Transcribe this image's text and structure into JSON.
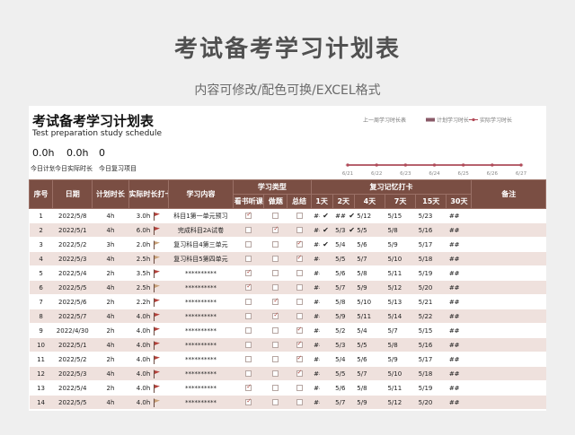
{
  "banner": {
    "title": "考试备考学习计划表",
    "subtitle": "内容可修改/配色可换/EXCEL格式"
  },
  "sheet": {
    "title": "考试备考学习计划表",
    "subtitle": "Test preparation study schedule",
    "stats": [
      {
        "value": "0.0h",
        "label": "今日计划"
      },
      {
        "value": "0.0h",
        "label": "今日实际时长"
      },
      {
        "value": "0",
        "label": "今日复习项目"
      }
    ]
  },
  "chart_data": {
    "type": "line",
    "title": "上一周学习时长表",
    "x": [
      "6/21",
      "6/22",
      "6/23",
      "6/24",
      "6/25",
      "6/26",
      "6/27"
    ],
    "series": [
      {
        "name": "计划学习时长",
        "values": [
          0,
          0,
          0,
          0,
          0,
          0,
          0
        ],
        "color": "#8a5a68"
      },
      {
        "name": "实际学习时长",
        "values": [
          0,
          0,
          0,
          0,
          0,
          0,
          0
        ],
        "color": "#b24a58"
      }
    ]
  },
  "table": {
    "headers": {
      "idx": "序号",
      "date": "日期",
      "plan": "计划时长",
      "actual": "实际时长打卡",
      "content": "学习内容",
      "type_group": "学习类型",
      "review_group": "复习记忆打卡",
      "note": "备注",
      "type_cols": [
        "看书听课",
        "做题",
        "总结"
      ],
      "review_cols": [
        "1天",
        "2天",
        "4天",
        "7天",
        "15天",
        "30天"
      ]
    },
    "rows": [
      {
        "idx": "1",
        "date": "2022/5/8",
        "plan": "4h",
        "actual": "3.0h",
        "flag": "red",
        "content": "科目1第一单元预习",
        "types": [
          1,
          0,
          0
        ],
        "r": [
          "##",
          "✔",
          "###",
          "✔",
          "5/12",
          "5/15",
          "5/23",
          "##"
        ]
      },
      {
        "idx": "2",
        "date": "2022/5/1",
        "plan": "4h",
        "actual": "6.0h",
        "flag": "red",
        "content": "完成科目2A试卷",
        "types": [
          0,
          1,
          0
        ],
        "r": [
          "##",
          "✔",
          "5/3",
          "✔",
          "5/5",
          "5/8",
          "5/16",
          "##"
        ]
      },
      {
        "idx": "3",
        "date": "2022/5/2",
        "plan": "3h",
        "actual": "2.0h",
        "flag": "tan",
        "content": "复习科目4第三单元",
        "types": [
          0,
          0,
          1
        ],
        "r": [
          "##",
          "✔",
          "5/4",
          "",
          "5/6",
          "5/9",
          "5/17",
          "##"
        ]
      },
      {
        "idx": "4",
        "date": "2022/5/3",
        "plan": "4h",
        "actual": "2.5h",
        "flag": "tan",
        "content": "复习科目5第四单元",
        "types": [
          0,
          0,
          1
        ],
        "r": [
          "##",
          "",
          "5/5",
          "",
          "5/7",
          "5/10",
          "5/18",
          "##"
        ]
      },
      {
        "idx": "5",
        "date": "2022/5/4",
        "plan": "2h",
        "actual": "3.5h",
        "flag": "red",
        "content": "**********",
        "types": [
          1,
          0,
          0
        ],
        "r": [
          "##",
          "",
          "5/6",
          "",
          "5/8",
          "5/11",
          "5/19",
          "##"
        ]
      },
      {
        "idx": "6",
        "date": "2022/5/5",
        "plan": "4h",
        "actual": "2.5h",
        "flag": "tan",
        "content": "**********",
        "types": [
          1,
          0,
          0
        ],
        "r": [
          "##",
          "",
          "5/7",
          "",
          "5/9",
          "5/12",
          "5/20",
          "##"
        ]
      },
      {
        "idx": "7",
        "date": "2022/5/6",
        "plan": "2h",
        "actual": "2.2h",
        "flag": "red",
        "content": "**********",
        "types": [
          0,
          1,
          0
        ],
        "r": [
          "##",
          "",
          "5/8",
          "",
          "5/10",
          "5/13",
          "5/21",
          "##"
        ]
      },
      {
        "idx": "8",
        "date": "2022/5/7",
        "plan": "4h",
        "actual": "4.0h",
        "flag": "red",
        "content": "**********",
        "types": [
          0,
          1,
          0
        ],
        "r": [
          "##",
          "",
          "5/9",
          "",
          "5/11",
          "5/14",
          "5/22",
          "##"
        ]
      },
      {
        "idx": "9",
        "date": "2022/4/30",
        "plan": "2h",
        "actual": "4.0h",
        "flag": "red",
        "content": "**********",
        "types": [
          0,
          0,
          1
        ],
        "r": [
          "##",
          "",
          "5/2",
          "",
          "5/4",
          "5/7",
          "5/15",
          "##"
        ]
      },
      {
        "idx": "10",
        "date": "2022/5/1",
        "plan": "4h",
        "actual": "4.0h",
        "flag": "red",
        "content": "**********",
        "types": [
          0,
          0,
          1
        ],
        "r": [
          "##",
          "",
          "5/3",
          "",
          "5/5",
          "5/8",
          "5/16",
          "##"
        ]
      },
      {
        "idx": "11",
        "date": "2022/5/2",
        "plan": "2h",
        "actual": "4.0h",
        "flag": "red",
        "content": "**********",
        "types": [
          0,
          0,
          1
        ],
        "r": [
          "##",
          "",
          "5/4",
          "",
          "5/6",
          "5/9",
          "5/17",
          "##"
        ]
      },
      {
        "idx": "12",
        "date": "2022/5/3",
        "plan": "4h",
        "actual": "4.0h",
        "flag": "red",
        "content": "**********",
        "types": [
          0,
          0,
          1
        ],
        "r": [
          "##",
          "",
          "5/5",
          "",
          "5/7",
          "5/10",
          "5/18",
          "##"
        ]
      },
      {
        "idx": "13",
        "date": "2022/5/4",
        "plan": "2h",
        "actual": "4.0h",
        "flag": "red",
        "content": "**********",
        "types": [
          1,
          0,
          0
        ],
        "r": [
          "##",
          "",
          "5/6",
          "",
          "5/8",
          "5/11",
          "5/19",
          "##"
        ]
      },
      {
        "idx": "14",
        "date": "2022/5/5",
        "plan": "4h",
        "actual": "4.0h",
        "flag": "tan",
        "content": "**********",
        "types": [
          1,
          0,
          0
        ],
        "r": [
          "##",
          "",
          "5/7",
          "",
          "5/9",
          "5/12",
          "5/20",
          "##"
        ]
      }
    ]
  }
}
